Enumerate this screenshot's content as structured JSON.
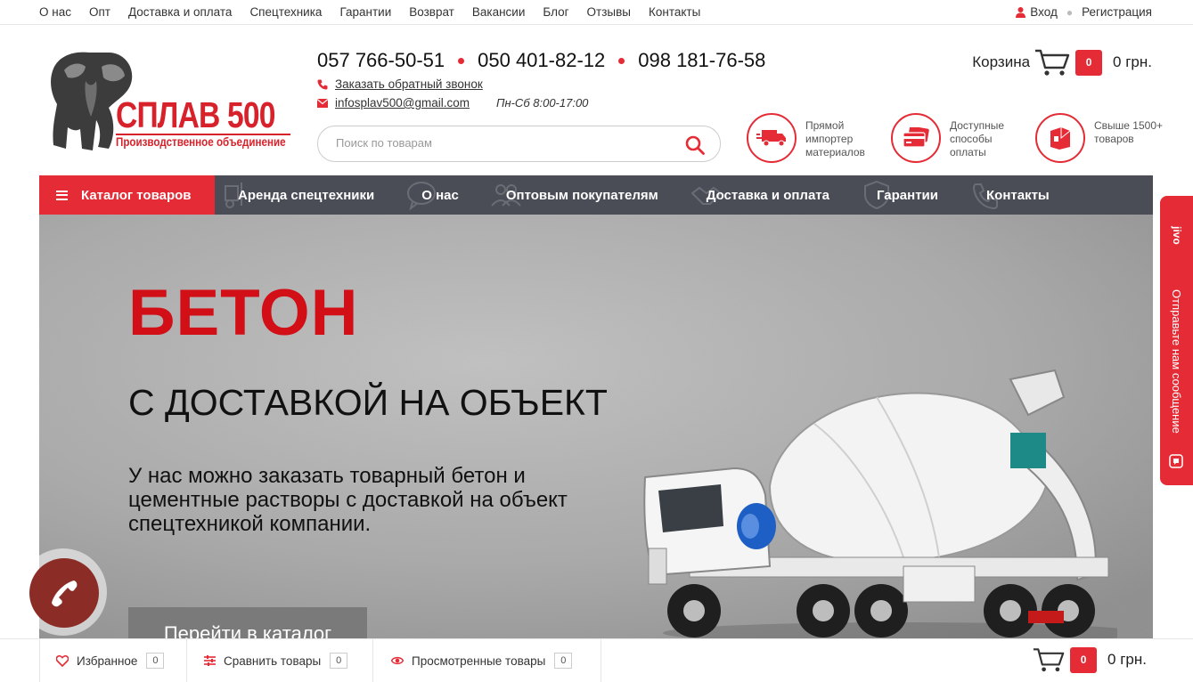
{
  "topnav": {
    "links": [
      "О нас",
      "Опт",
      "Доставка и оплата",
      "Спецтехника",
      "Гарантии",
      "Возврат",
      "Вакансии",
      "Блог",
      "Отзывы",
      "Контакты"
    ],
    "login": "Вход",
    "register": "Регистрация"
  },
  "logo": {
    "title": "СПЛАВ 500",
    "subtitle": "Производственное объединение"
  },
  "contacts": {
    "phones": [
      "057 766-50-51",
      "050 401-82-12",
      "098 181-76-58"
    ],
    "callback": "Заказать обратный звонок",
    "email": "infosplav500@gmail.com",
    "hours": "Пн-Сб 8:00-17:00"
  },
  "search": {
    "placeholder": "Поиск по товарам"
  },
  "cart": {
    "label": "Корзина",
    "count": "0",
    "sum": "0 грн."
  },
  "features": [
    {
      "icon": "truck-icon",
      "text": "Прямой импортер материалов"
    },
    {
      "icon": "card-icon",
      "text": "Доступные способы оплаты"
    },
    {
      "icon": "box-icon",
      "text": "Свыше 1500+ товаров"
    }
  ],
  "mainnav": {
    "catalog": "Каталог товаров",
    "items": [
      "Аренда спецтехники",
      "О нас",
      "Оптовым покупателям",
      "Доставка и оплата",
      "Гарантии",
      "Контакты"
    ]
  },
  "hero": {
    "title": "БЕТОН",
    "subtitle": "С ДОСТАВКОЙ НА ОБЪЕКТ",
    "text": "У нас можно заказать товарный бетон и цементные растворы с доставкой на объект спецтехникой компании.",
    "button": "Перейти в каталог"
  },
  "jivo": {
    "brand": "jivo",
    "text": "Отправьте нам сообщение"
  },
  "bottombar": {
    "favorites": "Избранное",
    "favorites_count": "0",
    "compare": "Сравнить товары",
    "compare_count": "0",
    "viewed": "Просмотренные товары",
    "viewed_count": "0",
    "cart_count": "0",
    "cart_sum": "0 грн."
  },
  "colors": {
    "accent": "#e52b35",
    "nav_bg": "#4a4c56",
    "hero_title": "#d20e17"
  }
}
